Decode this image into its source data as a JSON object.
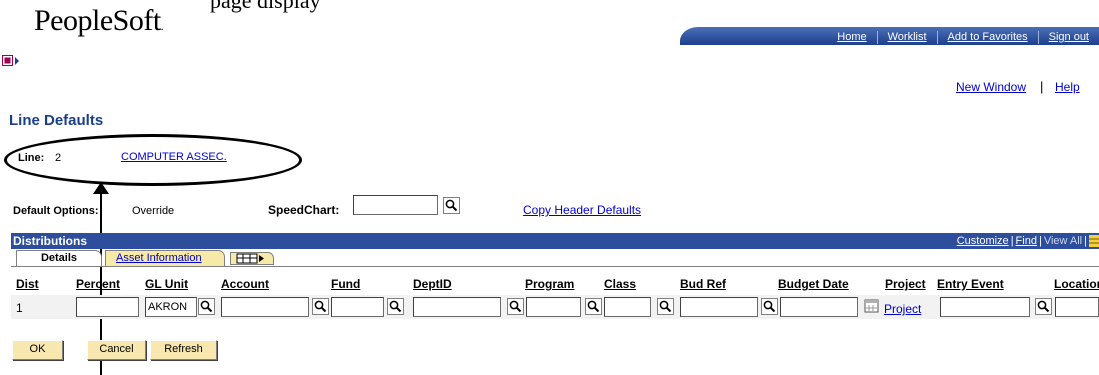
{
  "header": {
    "top_text": "page display",
    "logo": "PeopleSoft",
    "logo_mark": ".",
    "nav": [
      {
        "label": "Home"
      },
      {
        "label": "Worklist"
      },
      {
        "label": "Add to Favorites"
      },
      {
        "label": "Sign out"
      }
    ]
  },
  "toplinks": {
    "new_window": "New Window",
    "separator": "|",
    "help": "Help"
  },
  "page": {
    "title": "Line Defaults",
    "line_label": "Line:",
    "line_value": "2",
    "line_description": "COMPUTER ASSEC."
  },
  "options": {
    "default_options_label": "Default Options:",
    "default_options_value": "Override",
    "speedchart_label": "SpeedChart:",
    "speedchart_value": "",
    "copy_header_defaults": "Copy Header Defaults"
  },
  "grid": {
    "title": "Distributions",
    "tools": {
      "customize": "Customize",
      "find": "Find",
      "view_all": "View All",
      "sep": "|"
    },
    "tabs": [
      {
        "label": "Details"
      },
      {
        "label": "Asset Information"
      }
    ],
    "columns": [
      "Dist",
      "Percent",
      "GL Unit",
      "Account",
      "Fund",
      "DeptID",
      "Program",
      "Class",
      "Bud Ref",
      "Budget Date",
      "Project",
      "Entry Event",
      "Location"
    ],
    "rows": [
      {
        "dist": "1",
        "percent": "",
        "gl_unit": "AKRON",
        "account": "",
        "fund": "",
        "deptid": "",
        "program": "",
        "class": "",
        "bud_ref": "",
        "budget_date": "",
        "project_link": "Project",
        "entry_event": "",
        "location": ""
      }
    ]
  },
  "buttons": {
    "ok": "OK",
    "cancel": "Cancel",
    "refresh": "Refresh"
  },
  "colors": {
    "nav_bar": "#1e3f8c",
    "grid_header": "#2c4e9c",
    "button_bg": "#f8e8b0",
    "link": "#0000cc",
    "title": "#1b3f8b"
  },
  "icons": [
    "menu-toggle-icon",
    "lookup-icon",
    "calendar-icon",
    "grid-settings-icon",
    "show-all-columns-icon"
  ]
}
